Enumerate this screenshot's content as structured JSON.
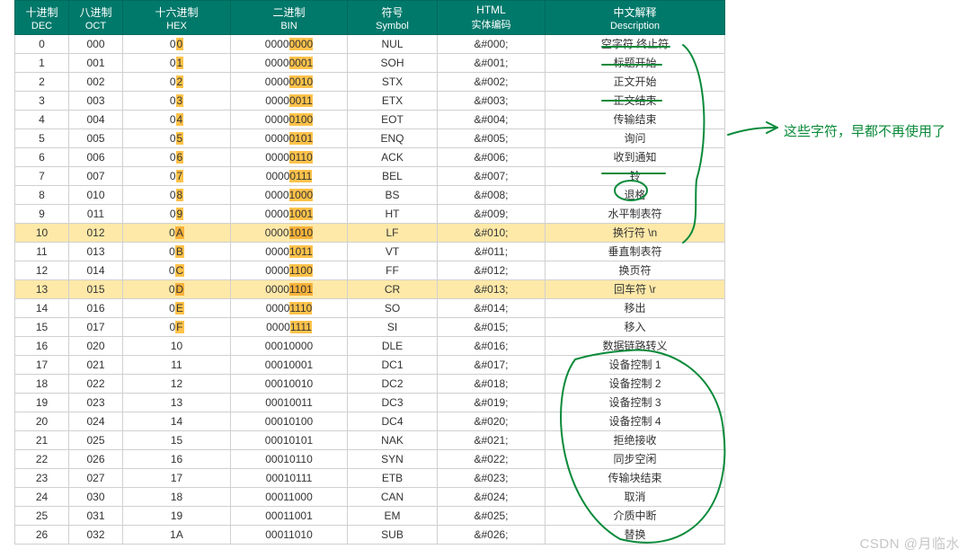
{
  "columns": [
    {
      "cn": "十进制",
      "en": "DEC",
      "w": "60"
    },
    {
      "cn": "八进制",
      "en": "OCT",
      "w": "60"
    },
    {
      "cn": "十六进制",
      "en": "HEX",
      "w": "120"
    },
    {
      "cn": "二进制",
      "en": "BIN",
      "w": "130"
    },
    {
      "cn": "符号",
      "en": "Symbol",
      "w": "100"
    },
    {
      "cn": "HTML",
      "en": "实体编码",
      "w": "120"
    },
    {
      "cn": "中文解释",
      "en": "Description",
      "w": "200"
    }
  ],
  "rows": [
    {
      "dec": "0",
      "oct": "000",
      "hex_pre": "0",
      "hex_last": "0",
      "bin_pre": "0000",
      "bin_last": "0000",
      "sym": "NUL",
      "ent": "&#000;",
      "desc": "空字符  终止符",
      "hl": false,
      "binhl": true
    },
    {
      "dec": "1",
      "oct": "001",
      "hex_pre": "0",
      "hex_last": "1",
      "bin_pre": "0000",
      "bin_last": "0001",
      "sym": "SOH",
      "ent": "&#001;",
      "desc": "标题开始",
      "hl": false,
      "binhl": true
    },
    {
      "dec": "2",
      "oct": "002",
      "hex_pre": "0",
      "hex_last": "2",
      "bin_pre": "0000",
      "bin_last": "0010",
      "sym": "STX",
      "ent": "&#002;",
      "desc": "正文开始",
      "hl": false,
      "binhl": true
    },
    {
      "dec": "3",
      "oct": "003",
      "hex_pre": "0",
      "hex_last": "3",
      "bin_pre": "0000",
      "bin_last": "0011",
      "sym": "ETX",
      "ent": "&#003;",
      "desc": "正文结束",
      "hl": false,
      "binhl": true
    },
    {
      "dec": "4",
      "oct": "004",
      "hex_pre": "0",
      "hex_last": "4",
      "bin_pre": "0000",
      "bin_last": "0100",
      "sym": "EOT",
      "ent": "&#004;",
      "desc": "传输结束",
      "hl": false,
      "binhl": true
    },
    {
      "dec": "5",
      "oct": "005",
      "hex_pre": "0",
      "hex_last": "5",
      "bin_pre": "0000",
      "bin_last": "0101",
      "sym": "ENQ",
      "ent": "&#005;",
      "desc": "询问",
      "hl": false,
      "binhl": true
    },
    {
      "dec": "6",
      "oct": "006",
      "hex_pre": "0",
      "hex_last": "6",
      "bin_pre": "0000",
      "bin_last": "0110",
      "sym": "ACK",
      "ent": "&#006;",
      "desc": "收到通知",
      "hl": false,
      "binhl": true
    },
    {
      "dec": "7",
      "oct": "007",
      "hex_pre": "0",
      "hex_last": "7",
      "bin_pre": "0000",
      "bin_last": "0111",
      "sym": "BEL",
      "ent": "&#007;",
      "desc": "铃",
      "hl": false,
      "binhl": true
    },
    {
      "dec": "8",
      "oct": "010",
      "hex_pre": "0",
      "hex_last": "8",
      "bin_pre": "0000",
      "bin_last": "1000",
      "sym": "BS",
      "ent": "&#008;",
      "desc": "退格",
      "hl": false,
      "binhl": true
    },
    {
      "dec": "9",
      "oct": "011",
      "hex_pre": "0",
      "hex_last": "9",
      "bin_pre": "0000",
      "bin_last": "1001",
      "sym": "HT",
      "ent": "&#009;",
      "desc": "水平制表符",
      "hl": false,
      "binhl": true
    },
    {
      "dec": "10",
      "oct": "012",
      "hex_pre": "0",
      "hex_last": "A",
      "bin_pre": "0000",
      "bin_last": "1010",
      "sym": "LF",
      "ent": "&#010;",
      "desc": "换行符 \\n",
      "hl": true,
      "binhl": true
    },
    {
      "dec": "11",
      "oct": "013",
      "hex_pre": "0",
      "hex_last": "B",
      "bin_pre": "0000",
      "bin_last": "1011",
      "sym": "VT",
      "ent": "&#011;",
      "desc": "垂直制表符",
      "hl": false,
      "binhl": true
    },
    {
      "dec": "12",
      "oct": "014",
      "hex_pre": "0",
      "hex_last": "C",
      "bin_pre": "0000",
      "bin_last": "1100",
      "sym": "FF",
      "ent": "&#012;",
      "desc": "换页符",
      "hl": false,
      "binhl": true
    },
    {
      "dec": "13",
      "oct": "015",
      "hex_pre": "0",
      "hex_last": "D",
      "bin_pre": "0000",
      "bin_last": "1101",
      "sym": "CR",
      "ent": "&#013;",
      "desc": "回车符 \\r",
      "hl": true,
      "binhl": true
    },
    {
      "dec": "14",
      "oct": "016",
      "hex_pre": "0",
      "hex_last": "E",
      "bin_pre": "0000",
      "bin_last": "1110",
      "sym": "SO",
      "ent": "&#014;",
      "desc": "移出",
      "hl": false,
      "binhl": true
    },
    {
      "dec": "15",
      "oct": "017",
      "hex_pre": "0",
      "hex_last": "F",
      "bin_pre": "0000",
      "bin_last": "1111",
      "sym": "SI",
      "ent": "&#015;",
      "desc": "移入",
      "hl": false,
      "binhl": true
    },
    {
      "dec": "16",
      "oct": "020",
      "hex_pre": "1",
      "hex_last": "0",
      "bin_pre": "0001",
      "bin_last": "0000",
      "sym": "DLE",
      "ent": "&#016;",
      "desc": "数据链路转义",
      "hl": false,
      "binhl": false
    },
    {
      "dec": "17",
      "oct": "021",
      "hex_pre": "1",
      "hex_last": "1",
      "bin_pre": "0001",
      "bin_last": "0001",
      "sym": "DC1",
      "ent": "&#017;",
      "desc": "设备控制 1",
      "hl": false,
      "binhl": false
    },
    {
      "dec": "18",
      "oct": "022",
      "hex_pre": "1",
      "hex_last": "2",
      "bin_pre": "0001",
      "bin_last": "0010",
      "sym": "DC2",
      "ent": "&#018;",
      "desc": "设备控制 2",
      "hl": false,
      "binhl": false
    },
    {
      "dec": "19",
      "oct": "023",
      "hex_pre": "1",
      "hex_last": "3",
      "bin_pre": "0001",
      "bin_last": "0011",
      "sym": "DC3",
      "ent": "&#019;",
      "desc": "设备控制 3",
      "hl": false,
      "binhl": false
    },
    {
      "dec": "20",
      "oct": "024",
      "hex_pre": "1",
      "hex_last": "4",
      "bin_pre": "0001",
      "bin_last": "0100",
      "sym": "DC4",
      "ent": "&#020;",
      "desc": "设备控制 4",
      "hl": false,
      "binhl": false
    },
    {
      "dec": "21",
      "oct": "025",
      "hex_pre": "1",
      "hex_last": "5",
      "bin_pre": "0001",
      "bin_last": "0101",
      "sym": "NAK",
      "ent": "&#021;",
      "desc": "拒绝接收",
      "hl": false,
      "binhl": false
    },
    {
      "dec": "22",
      "oct": "026",
      "hex_pre": "1",
      "hex_last": "6",
      "bin_pre": "0001",
      "bin_last": "0110",
      "sym": "SYN",
      "ent": "&#022;",
      "desc": "同步空闲",
      "hl": false,
      "binhl": false
    },
    {
      "dec": "23",
      "oct": "027",
      "hex_pre": "1",
      "hex_last": "7",
      "bin_pre": "0001",
      "bin_last": "0111",
      "sym": "ETB",
      "ent": "&#023;",
      "desc": "传输块结束",
      "hl": false,
      "binhl": false
    },
    {
      "dec": "24",
      "oct": "030",
      "hex_pre": "1",
      "hex_last": "8",
      "bin_pre": "0001",
      "bin_last": "1000",
      "sym": "CAN",
      "ent": "&#024;",
      "desc": "取消",
      "hl": false,
      "binhl": false
    },
    {
      "dec": "25",
      "oct": "031",
      "hex_pre": "1",
      "hex_last": "9",
      "bin_pre": "0001",
      "bin_last": "1001",
      "sym": "EM",
      "ent": "&#025;",
      "desc": "介质中断",
      "hl": false,
      "binhl": false
    },
    {
      "dec": "26",
      "oct": "032",
      "hex_pre": "1",
      "hex_last": "A",
      "bin_pre": "0001",
      "bin_last": "1010",
      "sym": "SUB",
      "ent": "&#026;",
      "desc": "替换",
      "hl": false,
      "binhl": false
    }
  ],
  "annotation": "这些字符，早都不再使用了",
  "watermark": "CSDN @月临水"
}
